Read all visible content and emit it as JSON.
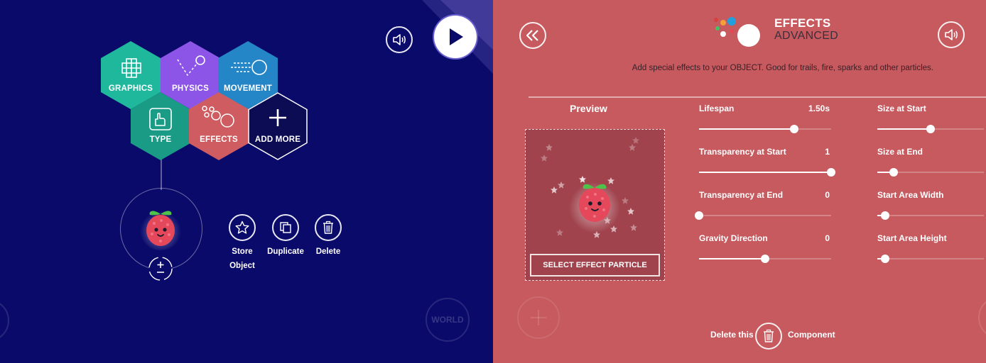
{
  "left": {
    "hexes": [
      {
        "id": "graphics",
        "label": "GRAPHICS",
        "color": "#1fb89d",
        "icon": "grid-icon"
      },
      {
        "id": "physics",
        "label": "PHYSICS",
        "color": "#8c55e8",
        "icon": "bounce-icon"
      },
      {
        "id": "movement",
        "label": "MOVEMENT",
        "color": "#2486c7",
        "icon": "motion-icon"
      },
      {
        "id": "type",
        "label": "TYPE",
        "color": "#1a9b86",
        "icon": "hand-icon"
      },
      {
        "id": "effects",
        "label": "EFFECTS",
        "color": "#cf5c60",
        "icon": "bubbles-icon"
      },
      {
        "id": "add_more",
        "label": "ADD MORE",
        "color": "#0c0c55",
        "icon": "plus-icon"
      }
    ],
    "actions": {
      "store": {
        "line1": "Store",
        "line2": "Object"
      },
      "duplicate": "Duplicate",
      "delete": "Delete"
    },
    "world_label": "WORLD"
  },
  "right": {
    "header": {
      "title": "EFFECTS",
      "subtitle": "ADVANCED"
    },
    "description": "Add special effects to your OBJECT. Good for trails, fire, sparks and other particles.",
    "preview_title": "Preview",
    "select_particle_label": "SELECT EFFECT PARTICLE",
    "sliders_col1": [
      {
        "id": "lifespan",
        "label": "Lifespan",
        "value": "1.50s",
        "level": 0.72
      },
      {
        "id": "transparency_start",
        "label": "Transparency at Start",
        "value": "1",
        "level": 1.0
      },
      {
        "id": "transparency_end",
        "label": "Transparency at End",
        "value": "0",
        "level": 0.0
      },
      {
        "id": "gravity",
        "label": "Gravity Direction",
        "value": "0",
        "level": 0.5
      }
    ],
    "sliders_col2": [
      {
        "id": "size_start",
        "label": "Size at Start",
        "level": 0.5
      },
      {
        "id": "size_end",
        "label": "Size at End",
        "level": 0.15
      },
      {
        "id": "area_width",
        "label": "Start Area Width",
        "level": 0.07
      },
      {
        "id": "area_height",
        "label": "Start Area Height",
        "level": 0.07
      }
    ],
    "delete_component": {
      "left": "Delete this",
      "right": "Component"
    }
  },
  "colors": {
    "left_bg": "#0a0a6b",
    "right_bg": "#c65a5f",
    "berry": "#e4485a",
    "leaf": "#4fc24a"
  }
}
